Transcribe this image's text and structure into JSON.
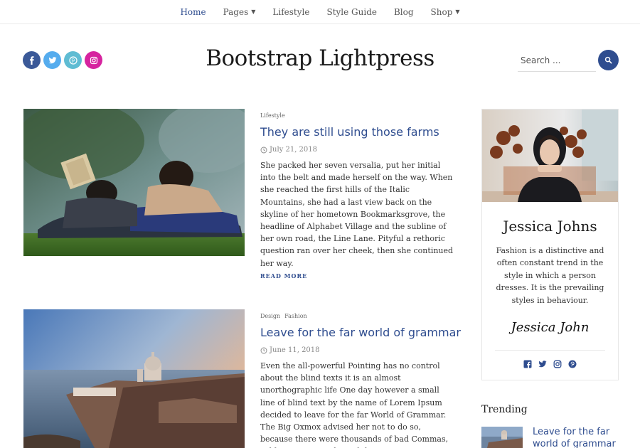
{
  "nav": {
    "items": [
      {
        "label": "Home",
        "active": true,
        "dropdown": false
      },
      {
        "label": "Pages",
        "active": false,
        "dropdown": true
      },
      {
        "label": "Lifestyle",
        "active": false,
        "dropdown": false
      },
      {
        "label": "Style Guide",
        "active": false,
        "dropdown": false
      },
      {
        "label": "Blog",
        "active": false,
        "dropdown": false
      },
      {
        "label": "Shop",
        "active": false,
        "dropdown": true
      }
    ]
  },
  "header": {
    "brand": "Bootstrap Lightpress",
    "social": [
      {
        "icon": "facebook-icon",
        "color": "#3b5998"
      },
      {
        "icon": "twitter-icon",
        "color": "#55acee"
      },
      {
        "icon": "pinterest-icon",
        "color": "#5fbcd3"
      },
      {
        "icon": "instagram-icon",
        "color": "#d6249f"
      }
    ],
    "search": {
      "placeholder": "Search ..."
    }
  },
  "posts": [
    {
      "categories": [
        "Lifestyle"
      ],
      "title": "They are still using those farms",
      "date": "July 21, 2018",
      "excerpt": "She packed her seven versalia, put her initial into the belt and made herself on the way. When she reached the first hills of the Italic Mountains, she had a last view back on the skyline of her hometown Bookmarksgrove, the headline of Alphabet Village and the subline of her own road, the Line Lane. Pityful a rethoric question ran over her cheek, then she continued her way.",
      "read_more": "READ MORE"
    },
    {
      "categories": [
        "Design",
        "Fashion"
      ],
      "title": "Leave for the far world of grammar",
      "date": "June 11, 2018",
      "excerpt": "Even the all-powerful Pointing has no control about the blind texts it is an almost unorthographic life One day however a small line of blind text by the name of Lorem Ipsum decided to leave for the far World of Grammar. The Big Oxmox advised her not to do so, because there were thousands of bad Commas, wild Question Marks and devious"
    }
  ],
  "sidebar": {
    "profile": {
      "name": "Jessica Johns",
      "bio": "Fashion is a distinctive and often constant trend in the style in which a person dresses. It is the prevailing styles in behaviour.",
      "signature": "Jessica John",
      "social": [
        "facebook-icon",
        "twitter-icon",
        "instagram-icon",
        "pinterest-icon"
      ]
    },
    "trending": {
      "title": "Trending",
      "items": [
        {
          "title": "Leave for the far world of grammar"
        }
      ]
    }
  },
  "colors": {
    "accent": "#2f4d8f"
  }
}
